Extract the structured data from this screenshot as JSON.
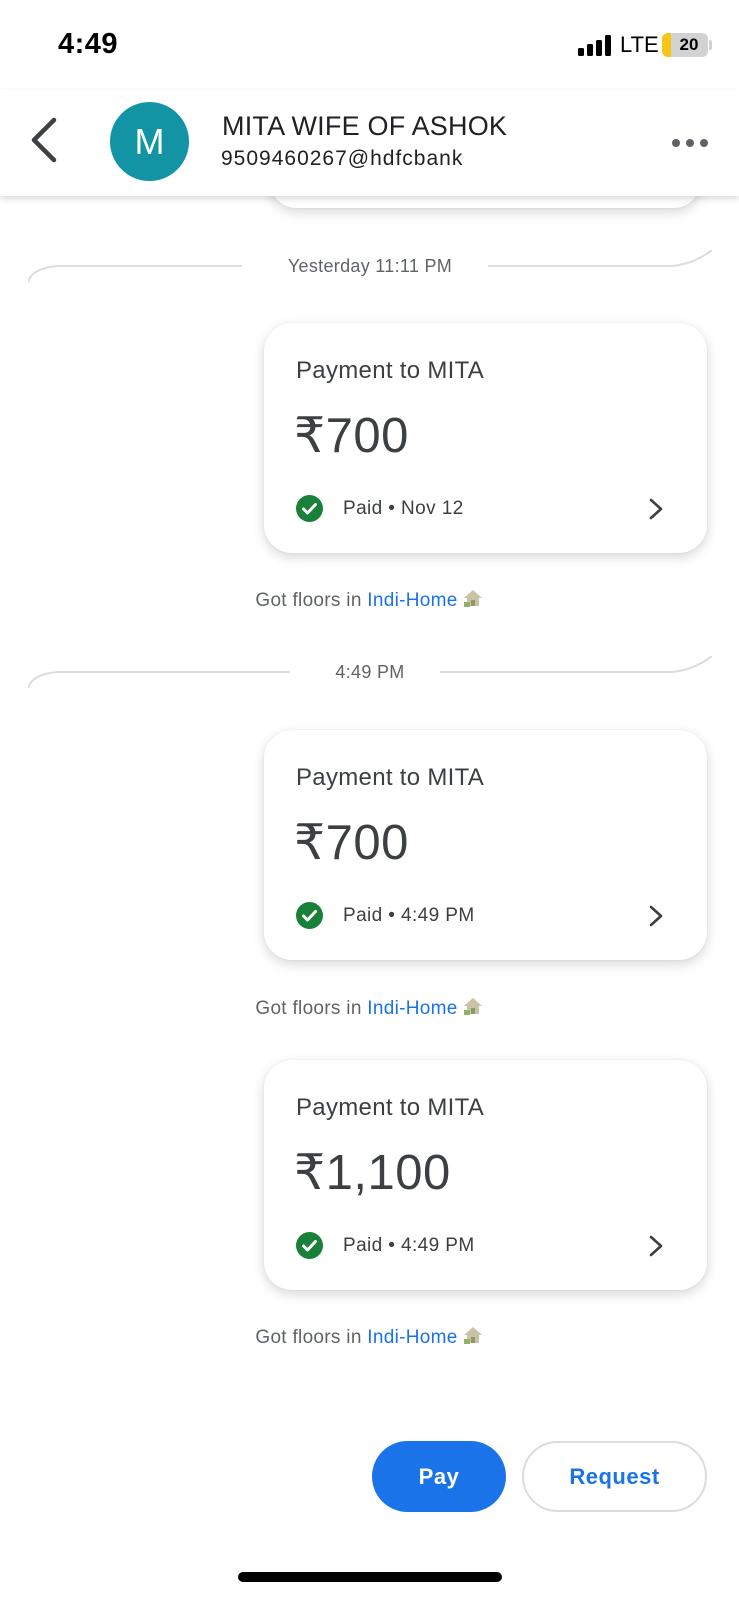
{
  "status_bar": {
    "time": "4:49",
    "network": "LTE",
    "battery": "20",
    "battery_level": 0.2
  },
  "header": {
    "avatar_letter": "M",
    "avatar_color": "#1394a5",
    "contact_name": "MITA WIFE OF ASHOK",
    "upi_id": "9509460267@hdfcbank",
    "icons": {
      "back": "back-arrow-icon",
      "more": "more-options-icon"
    }
  },
  "timeline": [
    {
      "type": "divider",
      "label": "Yesterday 11:11 PM"
    },
    {
      "type": "payment",
      "title": "Payment to MITA",
      "amount": "₹700",
      "status": "Paid • Nov 12"
    },
    {
      "type": "note",
      "text": "Got floors in ",
      "link": "Indi-Home",
      "icon": "house-icon"
    },
    {
      "type": "divider",
      "label": "4:49 PM"
    },
    {
      "type": "payment",
      "title": "Payment to MITA",
      "amount": "₹700",
      "status": "Paid • 4:49 PM"
    },
    {
      "type": "note",
      "text": "Got floors in ",
      "link": "Indi-Home",
      "icon": "house-icon"
    },
    {
      "type": "payment",
      "title": "Payment to MITA",
      "amount": "₹1,100",
      "status": "Paid • 4:49 PM"
    },
    {
      "type": "note",
      "text": "Got floors in ",
      "link": "Indi-Home",
      "icon": "house-icon"
    }
  ],
  "actions": {
    "pay_label": "Pay",
    "request_label": "Request"
  },
  "colors": {
    "accent": "#1a73e8",
    "paid_green": "#188038"
  }
}
